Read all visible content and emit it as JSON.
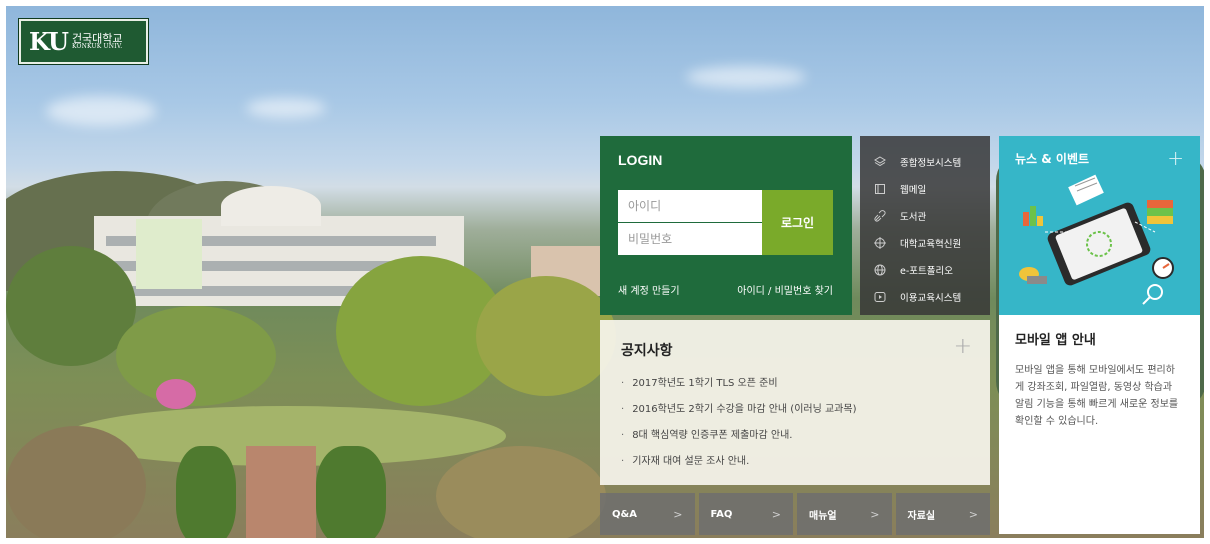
{
  "logo": {
    "mark": "KU",
    "name_kr": "건국대학교",
    "name_en": "KONKUK UNIV."
  },
  "login": {
    "title": "LOGIN",
    "id_placeholder": "아이디",
    "pw_placeholder": "비밀번호",
    "button": "로그인",
    "signup": "새 계정 만들기",
    "find": "아이디 / 비밀번호 찾기"
  },
  "quick_links": [
    {
      "label": "종합정보시스템",
      "icon": "layers-icon"
    },
    {
      "label": "웹메일",
      "icon": "book-icon"
    },
    {
      "label": "도서관",
      "icon": "link-icon"
    },
    {
      "label": "대학교육혁신원",
      "icon": "crosshair-icon"
    },
    {
      "label": "e-포트폴리오",
      "icon": "globe-icon"
    },
    {
      "label": "이용교육시스템",
      "icon": "play-icon"
    }
  ],
  "news": {
    "title": "뉴스 & 이벤트",
    "plus": "+",
    "app_title": "모바일 앱 안내",
    "app_desc": "모바일 앱을 통해 모바일에서도 편리하게 강좌조회, 파일열람, 동영상 학습과 알림 기능을 통해 빠르게 새로운 정보를 확인할 수 있습니다.",
    "accent": "#36b6c8"
  },
  "notice": {
    "title": "공지사항",
    "plus": "+",
    "items": [
      "2017학년도 1학기 TLS 오픈 준비",
      "2016학년도 2학기 수강을 마감 안내 (이러닝 교과목)",
      "8대 핵심역량 인증쿠폰 제출마감 안내.",
      "기자재 대여 설문 조사 안내."
    ]
  },
  "tabs": [
    {
      "label": "Q&A",
      "chev": ">"
    },
    {
      "label": "FAQ",
      "chev": ">"
    },
    {
      "label": "매뉴얼",
      "chev": ">"
    },
    {
      "label": "자료실",
      "chev": ">"
    }
  ],
  "colors": {
    "brand_green": "#1f6b3c",
    "login_button": "#7aaa2a",
    "logo_green": "#1f5a32"
  }
}
